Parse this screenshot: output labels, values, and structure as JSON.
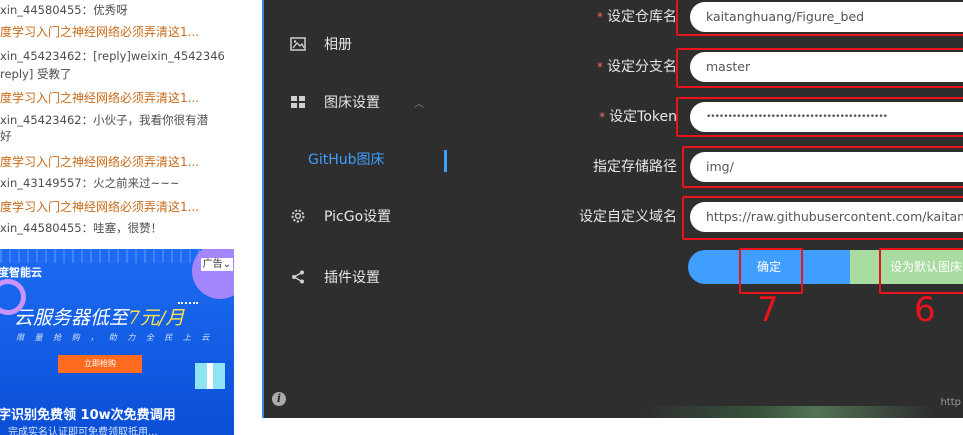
{
  "blog": {
    "comments": [
      {
        "text": "xin_44580455：优秀呀"
      },
      {
        "title": "度学习入门之神经网络必须弄清这1...",
        "text": "xin_45423462：[reply]weixin_4542346",
        "text2": "reply] 受教了"
      },
      {
        "title": "度学习入门之神经网络必须弄清这1...",
        "text": "xin_45423462：小伙子，我看你很有潜",
        "text2": "好"
      },
      {
        "title": "度学习入门之神经网络必须弄清这1...",
        "text": "xin_43149557：火之前来过~~~"
      },
      {
        "title": "度学习入门之神经网络必须弄清这1...",
        "text": "xin_44580455：哇塞，很赞！"
      }
    ],
    "ad": {
      "brand": "度智能云",
      "badge": "广告",
      "headline_pre": "云服务器低至",
      "headline_hl": "7元/月",
      "sub": "限 量 抢 购 ， 助 力 全 民 上 云",
      "button": "立即抢购",
      "bottom": "字识别免费领 10w次免费调用",
      "tiny": "完成实名认证即可免费领取抵用..."
    }
  },
  "picgo": {
    "nav": {
      "album": "相册",
      "picbed_settings": "图床设置",
      "github_picbed": "GitHub图床",
      "picgo_settings": "PicGo设置",
      "plugin_settings": "插件设置"
    },
    "form": {
      "repo_label": "设定仓库名",
      "repo_value": "kaitanghuang/Figure_bed",
      "branch_label": "设定分支名",
      "branch_value": "master",
      "token_label": "设定Token",
      "token_value": "••••••••••••••••••••••••••••••••••••••••••",
      "path_label": "指定存储路径",
      "path_value": "img/",
      "domain_label": "设定自定义域名",
      "domain_value": "https://raw.githubusercontent.com/kaitanghuang"
    },
    "buttons": {
      "confirm": "确定",
      "set_default": "设为默认图床"
    },
    "annotations": {
      "seven": "7",
      "six": "6"
    },
    "footer_link": "http"
  }
}
